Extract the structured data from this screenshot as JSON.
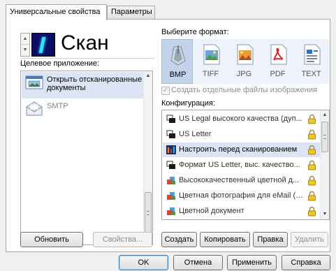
{
  "tabs": [
    {
      "label": "Универсальные свойства"
    },
    {
      "label": "Параметры"
    }
  ],
  "scan": {
    "title": "Скан"
  },
  "destination": {
    "label": "Целевое приложение:",
    "items": [
      {
        "label": "Открыть отсканированные документы",
        "icon": "open-documents-icon",
        "selected": true
      },
      {
        "label": "SMTP",
        "icon": "email-envelope-icon",
        "selected": false
      }
    ],
    "refresh_button": "Обновить",
    "properties_button": "Свойства..."
  },
  "format": {
    "label": "Выберите формат:",
    "items": [
      {
        "label": "BMP",
        "icon": "bmp-image-icon",
        "selected": true
      },
      {
        "label": "TIFF",
        "icon": "tiff-image-icon",
        "selected": false
      },
      {
        "label": "JPG",
        "icon": "jpg-image-icon",
        "selected": false
      },
      {
        "label": "PDF",
        "icon": "pdf-document-icon",
        "selected": false
      },
      {
        "label": "TEXT",
        "icon": "text-document-icon",
        "selected": false
      }
    ],
    "separate_files_label": "Создать отдельные файлы изображения",
    "separate_files_checked": true
  },
  "config": {
    "label": "Конфигурация:",
    "items": [
      {
        "label": "US Legal высокого качества (дуп...",
        "icon": "scanner-bw-icon",
        "selected": false
      },
      {
        "label": "US Letter",
        "icon": "scanner-bw-icon",
        "selected": false
      },
      {
        "label": "Настроить перед сканированием",
        "icon": "configure-icon",
        "selected": true
      },
      {
        "label": "Формат US Letter, выс. качество...",
        "icon": "scanner-bw-icon",
        "selected": false
      },
      {
        "label": "Высококачественный цветной д...",
        "icon": "color-scanner-icon",
        "selected": false
      },
      {
        "label": "Цветная фотография для eMail (6...",
        "icon": "color-scanner-icon",
        "selected": false
      },
      {
        "label": "Цветной документ",
        "icon": "color-scanner-icon",
        "selected": false
      }
    ],
    "buttons": {
      "create": "Создать",
      "copy": "Копировать",
      "edit": "Правка",
      "delete": "Удалить"
    }
  },
  "dialog_buttons": {
    "ok": "OK",
    "cancel": "Отмена",
    "apply": "Применить",
    "help": "Справка"
  }
}
